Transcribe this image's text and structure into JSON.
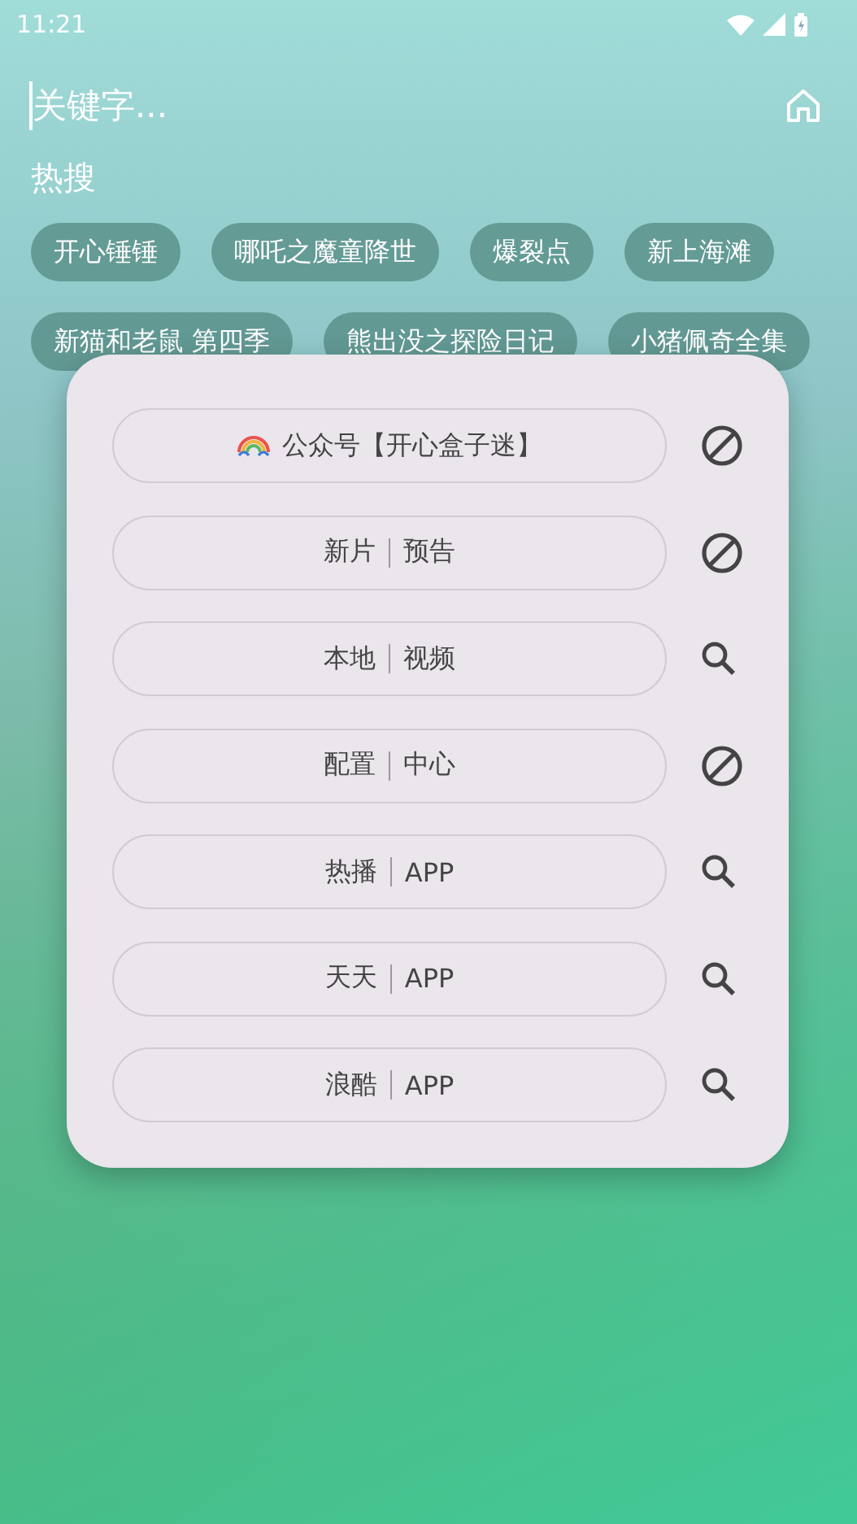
{
  "status_bar": {
    "time": "11:21"
  },
  "search": {
    "placeholder": "关键字..."
  },
  "hot": {
    "title": "热搜",
    "tags": [
      "开心锤锤",
      "哪吒之魔童降世",
      "爆裂点",
      "新上海滩",
      "新猫和老鼠 第四季",
      "熊出没之探险日记",
      "小猪佩奇全集"
    ]
  },
  "dialog": {
    "items": [
      {
        "kind": "logo",
        "left": "公众号【开心盒子迷】",
        "action": {
          "kind": "blocked"
        }
      },
      {
        "kind": "split",
        "left": "新片",
        "right": "预告",
        "action": {
          "kind": "blocked"
        }
      },
      {
        "kind": "split",
        "left": "本地",
        "right": "视频",
        "action": {
          "kind": "search"
        }
      },
      {
        "kind": "split",
        "left": "配置",
        "right": "中心",
        "action": {
          "kind": "blocked"
        }
      },
      {
        "kind": "split",
        "left": "热播",
        "right": "APP",
        "action": {
          "kind": "search"
        }
      },
      {
        "kind": "split",
        "left": "天天",
        "right": "APP",
        "action": {
          "kind": "search"
        }
      },
      {
        "kind": "split",
        "left": "浪酷",
        "right": "APP",
        "action": {
          "kind": "search"
        }
      }
    ]
  }
}
